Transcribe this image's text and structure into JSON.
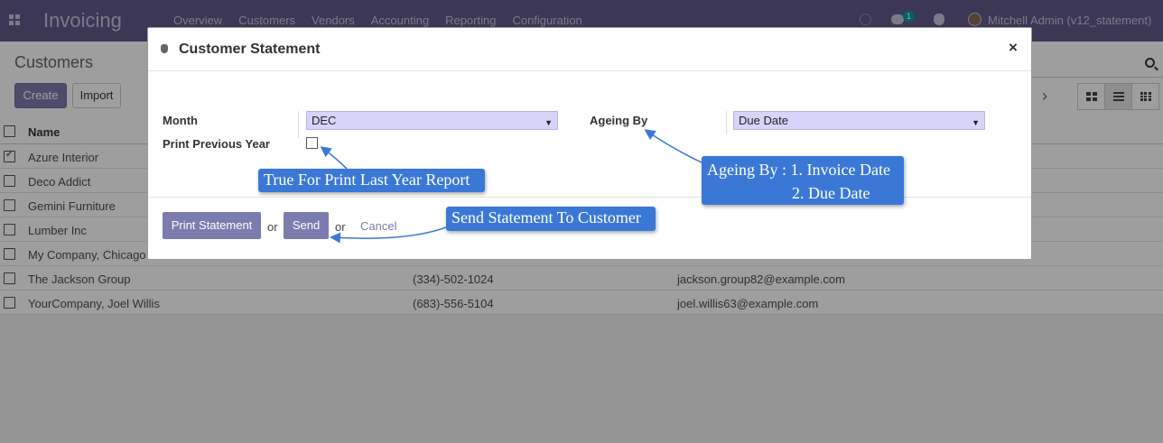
{
  "navbar": {
    "brand": "Invoicing",
    "menu": [
      "Overview",
      "Customers",
      "Vendors",
      "Accounting",
      "Reporting",
      "Configuration"
    ],
    "chat_badge": "1",
    "user": "Mitchell Admin (v12_statement)"
  },
  "control_panel": {
    "breadcrumb": "Customers",
    "create_label": "Create",
    "import_label": "Import"
  },
  "table": {
    "header": {
      "name": "Name"
    },
    "rows": [
      {
        "name": "Azure Interior",
        "phone": "",
        "email": "",
        "checked": true
      },
      {
        "name": "Deco Addict",
        "phone": "",
        "email": ""
      },
      {
        "name": "Gemini Furniture",
        "phone": "",
        "email": ""
      },
      {
        "name": "Lumber Inc",
        "phone": "",
        "email": ""
      },
      {
        "name": "My Company, Chicago",
        "phone": "",
        "email": ""
      },
      {
        "name": "The Jackson Group",
        "phone": "(334)-502-1024",
        "email": "jackson.group82@example.com"
      },
      {
        "name": "YourCompany, Joel Willis",
        "phone": "(683)-556-5104",
        "email": "joel.willis63@example.com"
      }
    ]
  },
  "modal": {
    "title": "Customer Statement",
    "close_glyph": "×",
    "month_label": "Month",
    "month_value": "DEC",
    "print_prev_label": "Print Previous Year",
    "ageing_label": "Ageing By",
    "ageing_value": "Due Date",
    "print_label": "Print Statement",
    "or_text": "or",
    "send_label": "Send",
    "cancel_label": "Cancel"
  },
  "annotations": {
    "print_prev_note": "True For Print Last Year Report",
    "ageing_note_1": "Ageing By : 1. Invoice Date",
    "ageing_note_2": "2. Due Date",
    "send_note": "Send Statement To Customer"
  },
  "colors": {
    "navbar": "#5f5a88",
    "primary_button": "#7c7bad",
    "select_bg": "#d6d4f8",
    "callout": "#3b78d6"
  },
  "icons": [
    "apps-grid-icon",
    "clock-icon",
    "chat-icon",
    "bug-icon",
    "avatar",
    "search-icon",
    "chevron-right-icon",
    "kanban-view-icon",
    "list-view-icon",
    "grid-view-icon",
    "close-icon"
  ]
}
